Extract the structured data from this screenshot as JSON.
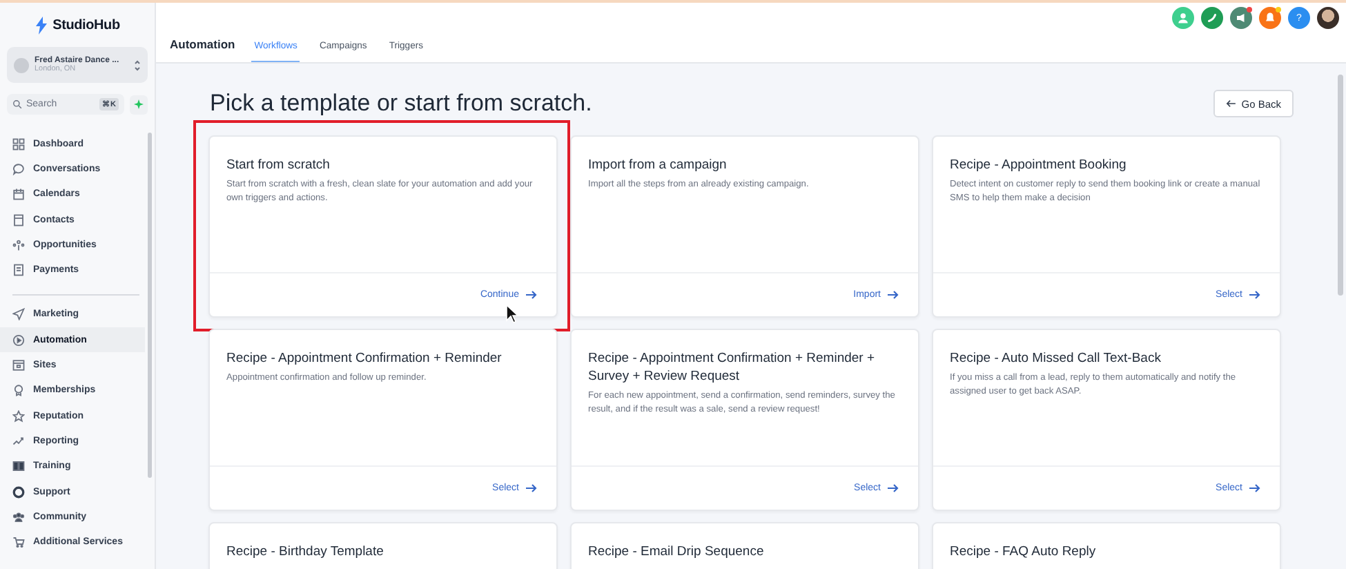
{
  "sidebar": {
    "logo": "StudioHub",
    "account": {
      "name": "Fred Astaire Dance ...",
      "location": "London, ON"
    },
    "search": {
      "placeholder": "Search",
      "shortcut": "⌘K"
    },
    "nav_groups": [
      [
        {
          "label": "Dashboard",
          "selected": false
        },
        {
          "label": "Conversations",
          "selected": false
        },
        {
          "label": "Calendars",
          "selected": false
        },
        {
          "label": "Contacts",
          "selected": false
        },
        {
          "label": "Opportunities",
          "selected": false
        },
        {
          "label": "Payments",
          "selected": false
        }
      ],
      [
        {
          "label": "Marketing",
          "selected": false
        },
        {
          "label": "Automation",
          "selected": true
        },
        {
          "label": "Sites",
          "selected": false
        },
        {
          "label": "Memberships",
          "selected": false
        },
        {
          "label": "Reputation",
          "selected": false
        },
        {
          "label": "Reporting",
          "selected": false
        },
        {
          "label": "Training",
          "selected": false
        },
        {
          "label": "Support",
          "selected": false
        },
        {
          "label": "Community",
          "selected": false
        },
        {
          "label": "Additional Services",
          "selected": false
        }
      ]
    ]
  },
  "header": {
    "section": "Automation",
    "tabs": [
      {
        "label": "Workflows",
        "selected": true
      },
      {
        "label": "Campaigns",
        "selected": false
      },
      {
        "label": "Triggers",
        "selected": false
      }
    ],
    "help": "?"
  },
  "page": {
    "title": "Pick a template or start from scratch.",
    "back_button": "Go Back",
    "templates": [
      {
        "title": "Start from scratch",
        "description": "Start from scratch with a fresh, clean slate for your automation and add your own triggers and actions.",
        "action": "Continue",
        "highlighted": true
      },
      {
        "title": "Import from a campaign",
        "description": "Import all the steps from an already existing campaign.",
        "action": "Import",
        "highlighted": false
      },
      {
        "title": "Recipe - Appointment Booking",
        "description": "Detect intent on customer reply to send them booking link or create a manual SMS to help them make a decision",
        "action": "Select",
        "highlighted": false
      },
      {
        "title": "Recipe - Appointment Confirmation + Reminder",
        "description": "Appointment confirmation and follow up reminder.",
        "action": "Select",
        "highlighted": false
      },
      {
        "title": "Recipe - Appointment Confirmation + Reminder + Survey + Review Request",
        "description": "For each new appointment, send a confirmation, send reminders, survey the result, and if the result was a sale, send a review request!",
        "action": "Select",
        "highlighted": false
      },
      {
        "title": "Recipe - Auto Missed Call Text-Back",
        "description": "If you miss a call from a lead, reply to them automatically and notify the assigned user to get back ASAP.",
        "action": "Select",
        "highlighted": false
      },
      {
        "title": "Recipe - Birthday Template",
        "highlighted": false
      },
      {
        "title": "Recipe - Email Drip Sequence",
        "highlighted": false
      },
      {
        "title": "Recipe - FAQ Auto Reply",
        "highlighted": false
      }
    ]
  }
}
